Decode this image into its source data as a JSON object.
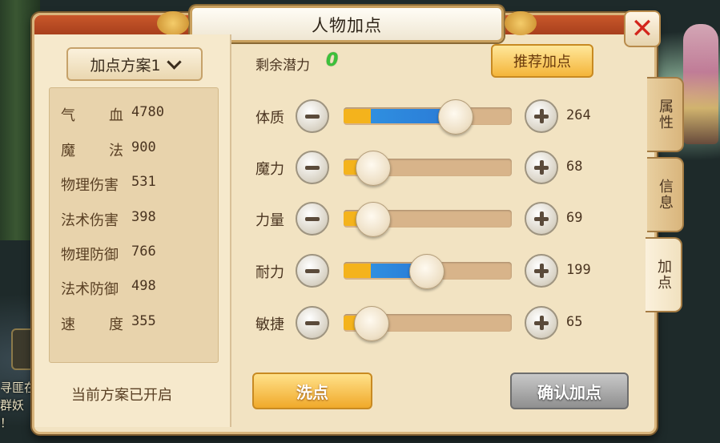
{
  "title": "人物加点",
  "close_icon": "close-icon",
  "scheme": {
    "label": "加点方案1",
    "icon": "chevron-down-icon"
  },
  "attributes": [
    {
      "name": "气　　血",
      "parts": [
        "气",
        "血"
      ],
      "value": "4780"
    },
    {
      "name": "魔　　法",
      "parts": [
        "魔",
        "法"
      ],
      "value": "900"
    },
    {
      "name": "物理伤害",
      "value": "531"
    },
    {
      "name": "法术伤害",
      "value": "398"
    },
    {
      "name": "物理防御",
      "value": "766"
    },
    {
      "name": "法术防御",
      "value": "498"
    },
    {
      "name": "速　　度",
      "parts": [
        "速",
        "度"
      ],
      "value": "355"
    }
  ],
  "status_text": "当前方案已开启",
  "potential": {
    "label": "剩余潜力",
    "value": "0"
  },
  "recommend_label": "推荐加点",
  "stats": [
    {
      "label": "体质",
      "value": "264",
      "level": 0.66
    },
    {
      "label": "魔力",
      "value": "68",
      "level": 0.17
    },
    {
      "label": "力量",
      "value": "69",
      "level": 0.17
    },
    {
      "label": "耐力",
      "value": "199",
      "level": 0.49
    },
    {
      "label": "敏捷",
      "value": "65",
      "level": 0.16
    }
  ],
  "wash_label": "洗点",
  "confirm_label": "确认加点",
  "tabs": [
    {
      "label": "属性",
      "active": false
    },
    {
      "label": "信息",
      "active": false
    },
    {
      "label": "加点",
      "active": true
    }
  ],
  "background_chat": [
    "寻匪在",
    "群妖",
    "！"
  ],
  "colors": {
    "accent": "#c9572a",
    "potential": "#3cc23a",
    "fill_blue": "#2f8fe0",
    "fill_orange": "#f4b31c"
  }
}
